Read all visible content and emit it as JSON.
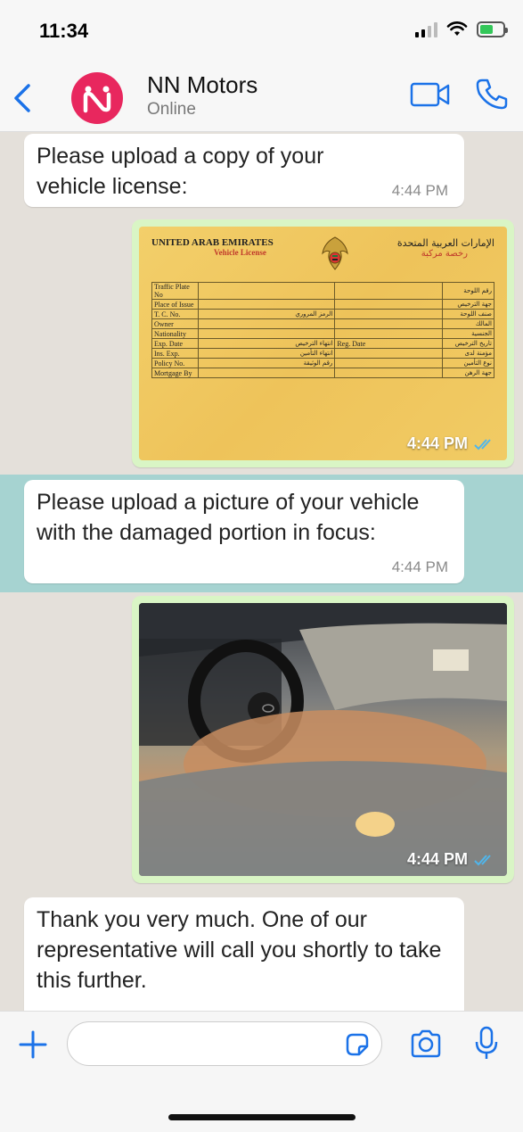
{
  "status_bar": {
    "time": "11:34"
  },
  "header": {
    "contact_name": "NN Motors",
    "contact_status": "Online",
    "avatar_color": "#e8275e",
    "accent_color": "#1b72e8",
    "icons": [
      "back-icon",
      "video-call-icon",
      "phone-icon"
    ]
  },
  "messages": [
    {
      "direction": "incoming",
      "text": "Please upload a copy of your vehicle license:",
      "time": "4:44 PM"
    },
    {
      "direction": "outgoing",
      "type": "image",
      "content": "vehicle-license",
      "time": "4:44 PM",
      "license": {
        "title_en": "UNITED ARAB EMIRATES",
        "subtitle_en": "Vehicle License",
        "title_ar": "الإمارات العربية المتحدة",
        "subtitle_ar": "رخصة مركبة",
        "rows": [
          {
            "en": "Traffic Plate No",
            "ar": "رقم اللوحة"
          },
          {
            "en": "Place of Issue",
            "ar": "جهة الترخيص"
          },
          {
            "en": "T. C. No.",
            "mid": "الرمز المروري",
            "ar": "صنف اللوحة"
          },
          {
            "en": "Owner",
            "ar": "المالك"
          },
          {
            "en": "Nationality",
            "ar": "الجنسية"
          },
          {
            "en": "Exp. Date",
            "mid": "انتهاء الترخيص",
            "mid2": "Reg. Date",
            "ar": "تاريخ الترخيص"
          },
          {
            "en": "Ins. Exp.",
            "mid": "انتهاء التأمين",
            "ar": "مؤمنة لدى"
          },
          {
            "en": "Policy No.",
            "mid": "رقم الوثيقة",
            "ar": "نوع التأمين"
          },
          {
            "en": "Mortgage By",
            "ar": "جهة الرهن"
          }
        ]
      }
    },
    {
      "direction": "incoming",
      "text": "Please upload a picture of your vehicle with the damaged portion in focus:",
      "time": "4:44 PM"
    },
    {
      "direction": "outgoing",
      "type": "image",
      "content": "flooded-car-interior",
      "time": "4:44 PM"
    },
    {
      "direction": "incoming",
      "text": "Thank you very much. One of our representative will call you shortly to take this further.",
      "time": ""
    }
  ],
  "input_bar": {
    "placeholder": "",
    "icons": [
      "plus-icon",
      "sticker-icon",
      "camera-icon",
      "microphone-icon"
    ]
  },
  "colors": {
    "incoming_bubble": "#ffffff",
    "outgoing_bubble": "#d9f5c5",
    "chat_background": "#e4e0da",
    "read_receipt": "#4fb6ec"
  }
}
